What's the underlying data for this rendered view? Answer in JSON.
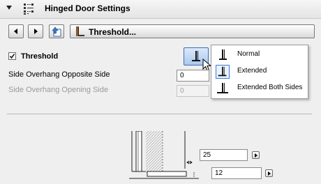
{
  "header": {
    "title": "Hinged Door Settings"
  },
  "nav": {
    "panel_title": "Threshold..."
  },
  "threshold": {
    "checkbox_label": "Threshold",
    "checked": true
  },
  "fields": [
    {
      "label": "Side Overhang Opposite Side",
      "value": "0",
      "enabled": true
    },
    {
      "label": "Side Overhang Opening Side",
      "value": "0",
      "enabled": false
    }
  ],
  "threshold_type_menu": {
    "options": [
      "Normal",
      "Extended",
      "Extended Both Sides"
    ],
    "highlighted": "Extended"
  },
  "dimensions": {
    "width": "25",
    "height": "12"
  }
}
